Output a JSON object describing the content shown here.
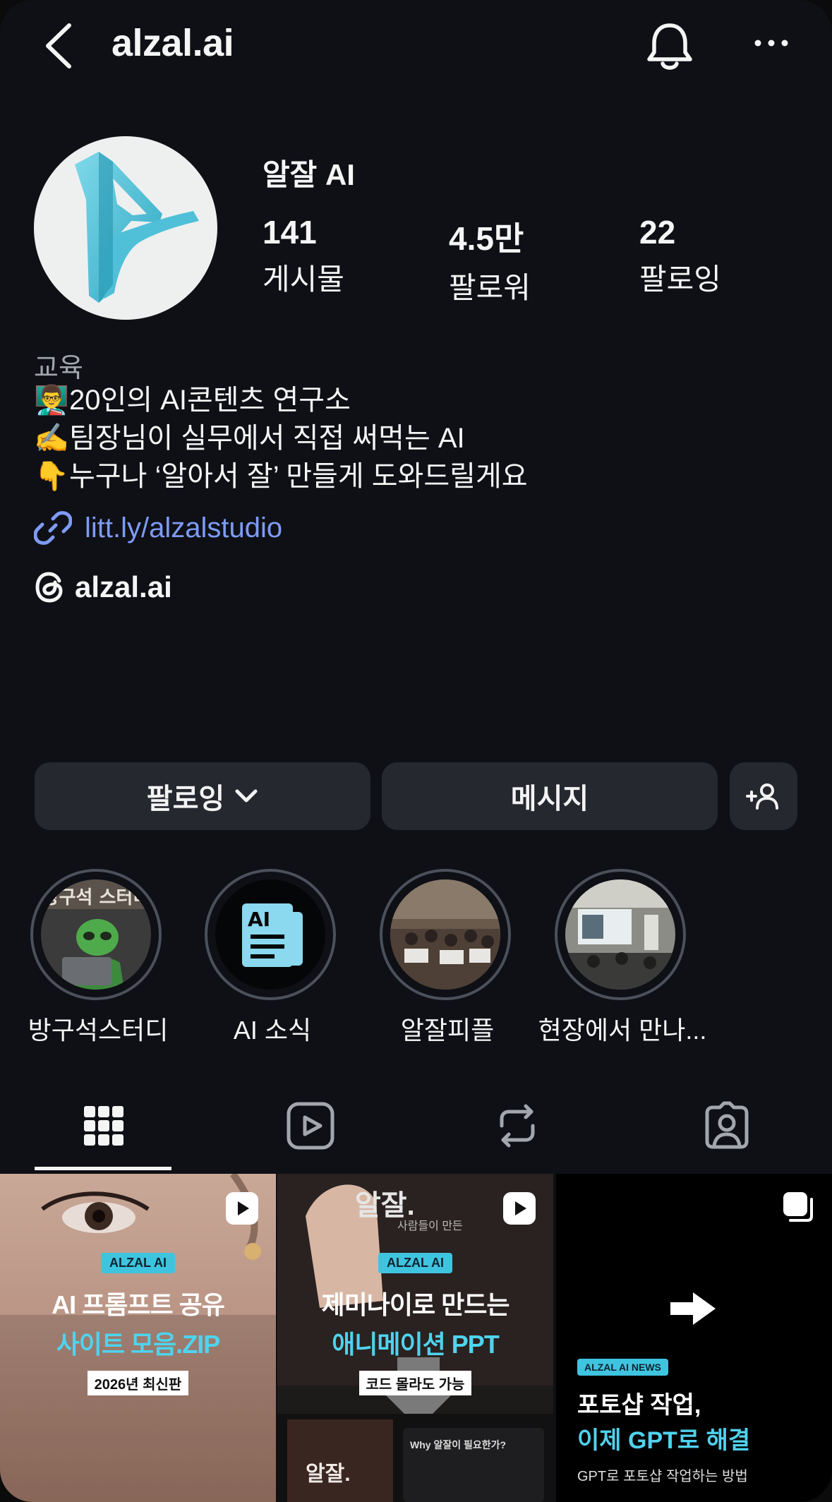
{
  "header": {
    "handle": "alzal.ai",
    "icons": [
      "back-arrow-icon",
      "bell-icon",
      "more-icon"
    ]
  },
  "profile": {
    "name": "알잘 AI",
    "stats": [
      {
        "value": "141",
        "label": "게시물"
      },
      {
        "value": "4.5만",
        "label": "팔로워"
      },
      {
        "value": "22",
        "label": "팔로잉"
      }
    ],
    "category": "교육",
    "bio": [
      {
        "emoji": "👨‍🏫",
        "text": "20인의 AI콘텐츠 연구소"
      },
      {
        "emoji": "✍️",
        "text": "팀장님이 실무에서 직접 써먹는 AI"
      },
      {
        "emoji": "👇",
        "text": "누구나 ‘알아서 잘’ 만들게 도와드릴게요"
      }
    ],
    "link": "litt.ly/alzalstudio",
    "threads_handle": "alzal.ai"
  },
  "actions": {
    "following": "팔로잉",
    "message": "메시지"
  },
  "highlights": [
    {
      "label": "방구석스터디"
    },
    {
      "label": "AI 소식"
    },
    {
      "label": "알잘피플"
    },
    {
      "label": "현장에서 만나..."
    }
  ],
  "tabs": [
    "grid-icon",
    "reels-icon",
    "reposts-icon",
    "tagged-icon"
  ],
  "posts": [
    {
      "badge": "ALZAL AI",
      "line1": "AI 프롬프트 공유",
      "line2": "사이트 모음.ZIP",
      "sub": "2026년 최신판"
    },
    {
      "badge": "ALZAL AI",
      "line1": "제미나이로 만드는",
      "line2": "애니메이션 PPT",
      "sub": "코드 몰라도 가능",
      "bg_big": "알잘.",
      "bg_small": "사람들이 만든",
      "bg_title": "Why 알잘이 필요한가?"
    },
    {
      "badge": "ALZAL AI NEWS",
      "line1": "포토샵 작업,",
      "line2": "이제 GPT로 해결",
      "sub": "GPT로 포토샵 작업하는 방법"
    }
  ],
  "colors": {
    "background": "#0e1016",
    "button": "#25282f",
    "link": "#7e9bf5",
    "accent_cyan": "#3fc4e0"
  }
}
